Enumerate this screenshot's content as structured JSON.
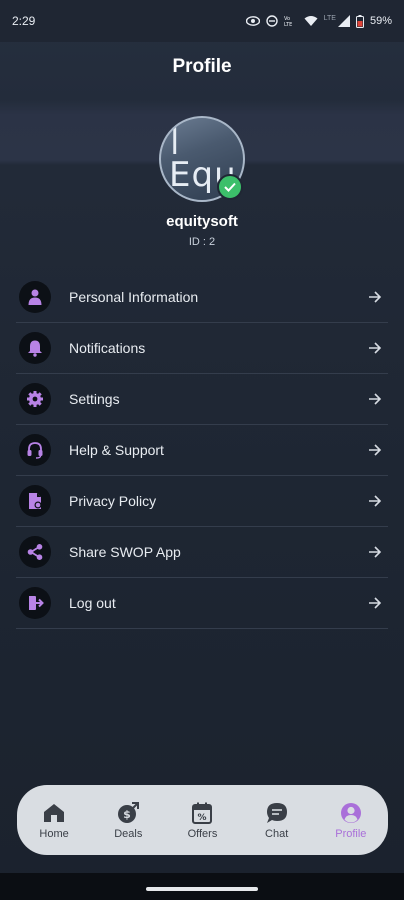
{
  "status_bar": {
    "time": "2:29",
    "battery": "59%",
    "network_label": "LTE"
  },
  "header": {
    "title": "Profile"
  },
  "profile": {
    "avatar_text": "| Equ",
    "username": "equitysoft",
    "user_id": "ID : 2"
  },
  "menu": {
    "items": [
      {
        "label": "Personal Information",
        "icon": "person-icon"
      },
      {
        "label": "Notifications",
        "icon": "bell-icon"
      },
      {
        "label": "Settings",
        "icon": "gear-icon"
      },
      {
        "label": "Help & Support",
        "icon": "headset-icon"
      },
      {
        "label": "Privacy Policy",
        "icon": "document-icon"
      },
      {
        "label": "Share SWOP App",
        "icon": "share-icon"
      },
      {
        "label": "Log out",
        "icon": "logout-icon"
      }
    ]
  },
  "bottom_nav": {
    "items": [
      {
        "label": "Home",
        "icon": "home-icon"
      },
      {
        "label": "Deals",
        "icon": "deals-icon"
      },
      {
        "label": "Offers",
        "icon": "offers-icon"
      },
      {
        "label": "Chat",
        "icon": "chat-icon"
      },
      {
        "label": "Profile",
        "icon": "profile-icon",
        "active": true
      }
    ]
  },
  "colors": {
    "accent": "#a96fd9",
    "background": "#1c2430",
    "nav_background": "#d9dde2",
    "verified": "#3cbf6a"
  }
}
